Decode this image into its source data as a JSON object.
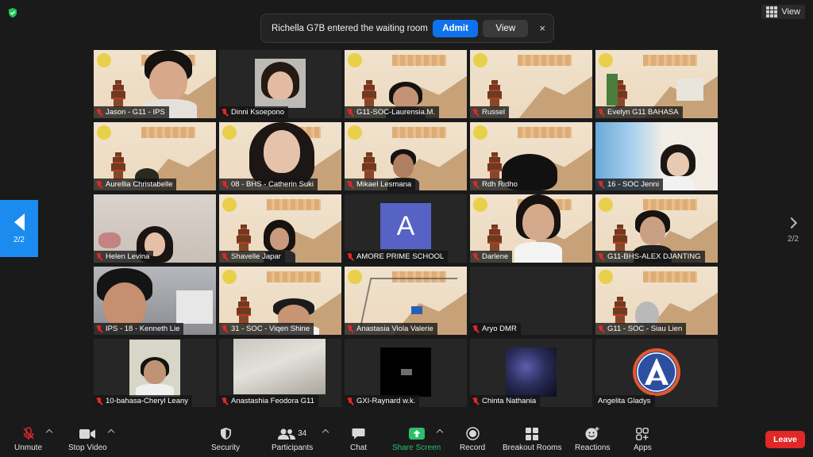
{
  "notification": {
    "text": "Richella G7B entered the waiting room",
    "admit_label": "Admit",
    "view_label": "View",
    "close_icon": "×"
  },
  "top_bar": {
    "view_label": "View"
  },
  "pagination": {
    "left_page": "2/2",
    "right_page": "2/2"
  },
  "participants": [
    {
      "name": "Jason - G11 - IPS"
    },
    {
      "name": "Dinni Ksoepono"
    },
    {
      "name": "G11-SOC-Laurensia.M."
    },
    {
      "name": "Russel"
    },
    {
      "name": "Evelyn G11 BAHASA"
    },
    {
      "name": "Aurellia Christabelle"
    },
    {
      "name": "08 - BHS - Catherin Suki"
    },
    {
      "name": "Mikael Lesmana"
    },
    {
      "name": "Rdh Ridho"
    },
    {
      "name": "16 - SOC Jenni"
    },
    {
      "name": "Helen Levina"
    },
    {
      "name": "Shavelle Japar"
    },
    {
      "name": "AMORE PRIME SCHOOL",
      "avatar_letter": "A"
    },
    {
      "name": "Darlene"
    },
    {
      "name": "G11-BHS-ALEX DJANTING"
    },
    {
      "name": "IPS - 18 - Kenneth Lie"
    },
    {
      "name": "31 - SOC - Viqen Shine"
    },
    {
      "name": "Anastasia Viola Valerie"
    },
    {
      "name": "Aryo DMR"
    },
    {
      "name": "G11 - SOC - Siau Lien"
    },
    {
      "name": "10-bahasa-Cheryl Leany"
    },
    {
      "name": "Anastashia Feodora G11"
    },
    {
      "name": "GXI-Raynard w.k."
    },
    {
      "name": "Chinta Nathania"
    },
    {
      "name": "Angelita Gladys"
    }
  ],
  "toolbar": {
    "unmute": "Unmute",
    "stop_video": "Stop Video",
    "security": "Security",
    "participants": "Participants",
    "participants_count": "34",
    "chat": "Chat",
    "share_screen": "Share Screen",
    "record": "Record",
    "breakout_rooms": "Breakout Rooms",
    "reactions": "Reactions",
    "apps": "Apps",
    "leave": "Leave"
  },
  "colors": {
    "accent_blue": "#0e72ed",
    "page_nav_blue": "#1b8bf0",
    "leave_red": "#e02828",
    "share_green": "#2dbf6b",
    "shield_green": "#23c552"
  }
}
